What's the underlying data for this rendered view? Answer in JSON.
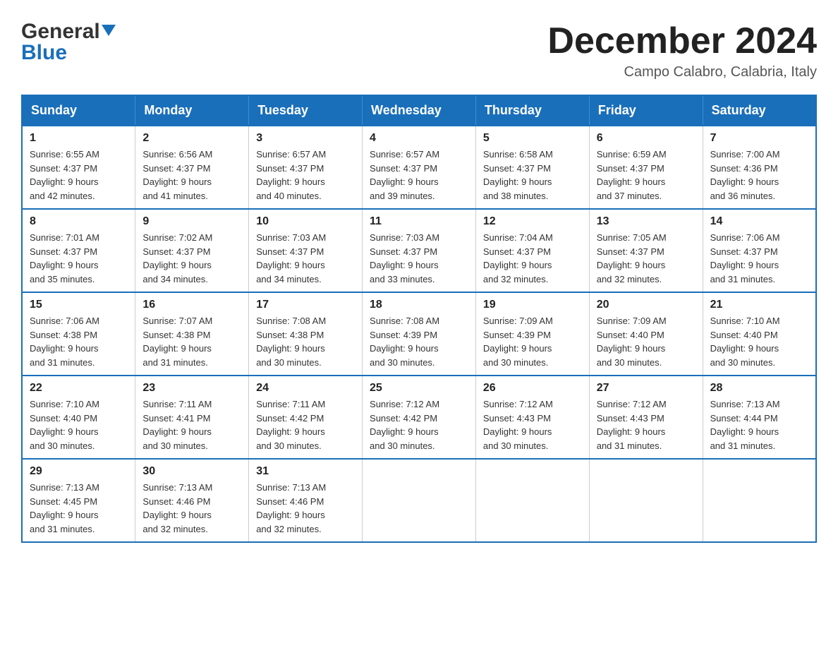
{
  "logo": {
    "general": "General",
    "triangle": "▶",
    "blue": "Blue"
  },
  "title": {
    "month": "December 2024",
    "location": "Campo Calabro, Calabria, Italy"
  },
  "weekdays": [
    "Sunday",
    "Monday",
    "Tuesday",
    "Wednesday",
    "Thursday",
    "Friday",
    "Saturday"
  ],
  "weeks": [
    [
      {
        "day": "1",
        "sunrise": "6:55 AM",
        "sunset": "4:37 PM",
        "daylight": "9 hours and 42 minutes."
      },
      {
        "day": "2",
        "sunrise": "6:56 AM",
        "sunset": "4:37 PM",
        "daylight": "9 hours and 41 minutes."
      },
      {
        "day": "3",
        "sunrise": "6:57 AM",
        "sunset": "4:37 PM",
        "daylight": "9 hours and 40 minutes."
      },
      {
        "day": "4",
        "sunrise": "6:57 AM",
        "sunset": "4:37 PM",
        "daylight": "9 hours and 39 minutes."
      },
      {
        "day": "5",
        "sunrise": "6:58 AM",
        "sunset": "4:37 PM",
        "daylight": "9 hours and 38 minutes."
      },
      {
        "day": "6",
        "sunrise": "6:59 AM",
        "sunset": "4:37 PM",
        "daylight": "9 hours and 37 minutes."
      },
      {
        "day": "7",
        "sunrise": "7:00 AM",
        "sunset": "4:36 PM",
        "daylight": "9 hours and 36 minutes."
      }
    ],
    [
      {
        "day": "8",
        "sunrise": "7:01 AM",
        "sunset": "4:37 PM",
        "daylight": "9 hours and 35 minutes."
      },
      {
        "day": "9",
        "sunrise": "7:02 AM",
        "sunset": "4:37 PM",
        "daylight": "9 hours and 34 minutes."
      },
      {
        "day": "10",
        "sunrise": "7:03 AM",
        "sunset": "4:37 PM",
        "daylight": "9 hours and 34 minutes."
      },
      {
        "day": "11",
        "sunrise": "7:03 AM",
        "sunset": "4:37 PM",
        "daylight": "9 hours and 33 minutes."
      },
      {
        "day": "12",
        "sunrise": "7:04 AM",
        "sunset": "4:37 PM",
        "daylight": "9 hours and 32 minutes."
      },
      {
        "day": "13",
        "sunrise": "7:05 AM",
        "sunset": "4:37 PM",
        "daylight": "9 hours and 32 minutes."
      },
      {
        "day": "14",
        "sunrise": "7:06 AM",
        "sunset": "4:37 PM",
        "daylight": "9 hours and 31 minutes."
      }
    ],
    [
      {
        "day": "15",
        "sunrise": "7:06 AM",
        "sunset": "4:38 PM",
        "daylight": "9 hours and 31 minutes."
      },
      {
        "day": "16",
        "sunrise": "7:07 AM",
        "sunset": "4:38 PM",
        "daylight": "9 hours and 31 minutes."
      },
      {
        "day": "17",
        "sunrise": "7:08 AM",
        "sunset": "4:38 PM",
        "daylight": "9 hours and 30 minutes."
      },
      {
        "day": "18",
        "sunrise": "7:08 AM",
        "sunset": "4:39 PM",
        "daylight": "9 hours and 30 minutes."
      },
      {
        "day": "19",
        "sunrise": "7:09 AM",
        "sunset": "4:39 PM",
        "daylight": "9 hours and 30 minutes."
      },
      {
        "day": "20",
        "sunrise": "7:09 AM",
        "sunset": "4:40 PM",
        "daylight": "9 hours and 30 minutes."
      },
      {
        "day": "21",
        "sunrise": "7:10 AM",
        "sunset": "4:40 PM",
        "daylight": "9 hours and 30 minutes."
      }
    ],
    [
      {
        "day": "22",
        "sunrise": "7:10 AM",
        "sunset": "4:40 PM",
        "daylight": "9 hours and 30 minutes."
      },
      {
        "day": "23",
        "sunrise": "7:11 AM",
        "sunset": "4:41 PM",
        "daylight": "9 hours and 30 minutes."
      },
      {
        "day": "24",
        "sunrise": "7:11 AM",
        "sunset": "4:42 PM",
        "daylight": "9 hours and 30 minutes."
      },
      {
        "day": "25",
        "sunrise": "7:12 AM",
        "sunset": "4:42 PM",
        "daylight": "9 hours and 30 minutes."
      },
      {
        "day": "26",
        "sunrise": "7:12 AM",
        "sunset": "4:43 PM",
        "daylight": "9 hours and 30 minutes."
      },
      {
        "day": "27",
        "sunrise": "7:12 AM",
        "sunset": "4:43 PM",
        "daylight": "9 hours and 31 minutes."
      },
      {
        "day": "28",
        "sunrise": "7:13 AM",
        "sunset": "4:44 PM",
        "daylight": "9 hours and 31 minutes."
      }
    ],
    [
      {
        "day": "29",
        "sunrise": "7:13 AM",
        "sunset": "4:45 PM",
        "daylight": "9 hours and 31 minutes."
      },
      {
        "day": "30",
        "sunrise": "7:13 AM",
        "sunset": "4:46 PM",
        "daylight": "9 hours and 32 minutes."
      },
      {
        "day": "31",
        "sunrise": "7:13 AM",
        "sunset": "4:46 PM",
        "daylight": "9 hours and 32 minutes."
      },
      null,
      null,
      null,
      null
    ]
  ],
  "labels": {
    "sunrise": "Sunrise:",
    "sunset": "Sunset:",
    "daylight": "Daylight:"
  }
}
